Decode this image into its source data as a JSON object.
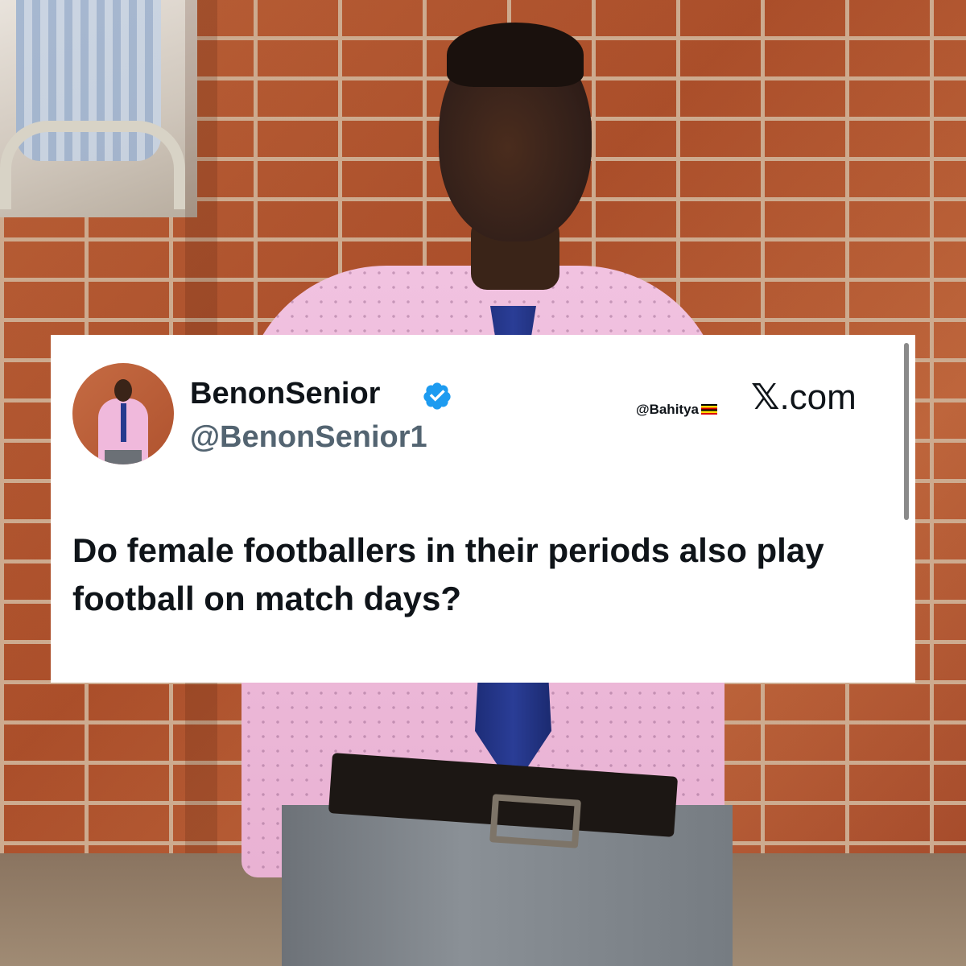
{
  "tweet": {
    "display_name": "BenonSenior",
    "handle": "@BenonSenior1",
    "verified": true,
    "text": "Do female footballers in their periods also play football on match days?"
  },
  "watermark": "@Bahitya",
  "brand": {
    "x_glyph": "𝕏",
    "domain": ".com"
  },
  "icons": {
    "verified": "verified-badge-icon",
    "flag": "uganda-flag-icon"
  },
  "colors": {
    "verified_blue": "#1d9bf0",
    "text_primary": "#0f1419",
    "text_secondary": "#536471"
  }
}
